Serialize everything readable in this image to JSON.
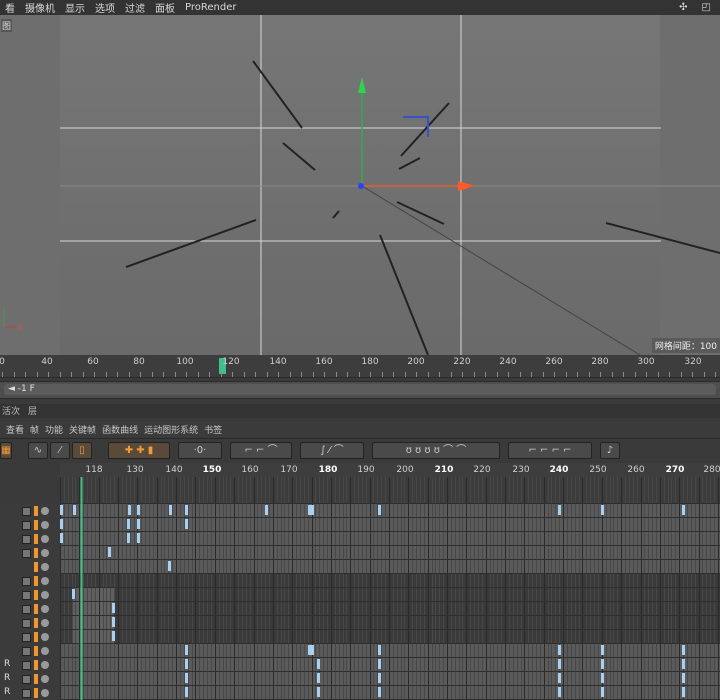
{
  "menu": [
    "看",
    "摄像机",
    "显示",
    "选项",
    "过滤",
    "面板",
    "ProRender"
  ],
  "viewport": {
    "label": "图",
    "grid_spacing_label": "网格间距：100"
  },
  "ruler": {
    "ticks": [
      "0",
      "40",
      "60",
      "80",
      "100",
      "120",
      "140",
      "160",
      "180",
      "200",
      "220",
      "240",
      "260",
      "280",
      "300",
      "320"
    ],
    "current_frame": 119
  },
  "frame_field": {
    "value": "◄ -1 F"
  },
  "tabs": [
    "活次",
    "层"
  ],
  "timeline_menu": [
    "查看",
    "帧",
    "功能",
    "关键帧",
    "函数曲线",
    "运动图形系统",
    "书签"
  ],
  "timeline": {
    "frames": [
      "118",
      "130",
      "140",
      "150",
      "160",
      "170",
      "180",
      "190",
      "200",
      "210",
      "220",
      "230",
      "240",
      "250",
      "260",
      "270",
      "280"
    ],
    "bold_frames": [
      "150",
      "180",
      "210",
      "240",
      "270"
    ],
    "row_labels": [
      "",
      "",
      "",
      "",
      "",
      "",
      "",
      "",
      "",
      "",
      "",
      "R",
      "R",
      "R"
    ]
  },
  "colors": {
    "accent": "#3fbf8a",
    "key": "#a8d0f0",
    "orange": "#f0962e"
  }
}
